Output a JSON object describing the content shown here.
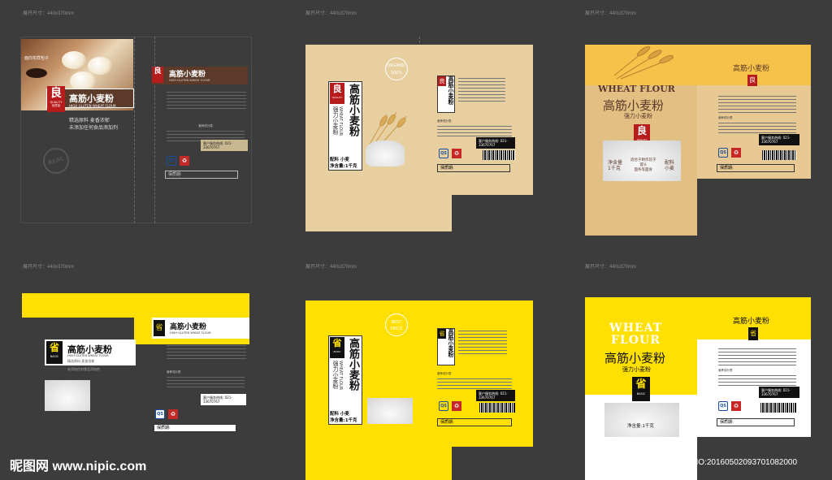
{
  "dim_label": "展开尺寸：440x370mm",
  "brand_liang": "良",
  "brand_quality": "QUALITY",
  "brand_quality_cn": "优质品",
  "brand_sheng": "省",
  "brand_basic": "BASIC",
  "brand_basic_cn": "划算价",
  "product_cn": "高筋小麦粉",
  "product_en": "HIGH GLUTEN WHEAT FLOUR",
  "wheat_flour": "WHEAT FLOUR",
  "wheat_flour_l1": "WHEAT",
  "wheat_flour_l2": "FLOUR",
  "strong_flour": "强力小麦粉",
  "ingredients": "配料 小麦",
  "ingredients_v": "配料\n小麦",
  "net_content": "净含量:1千克",
  "net_content_short": "净含量\n1千克",
  "tagline1": "精选原料 麦香浓郁",
  "tagline2": "未添加任何食品添加剂",
  "usage": "适合于制作饺子\n馒头\n面条等面食",
  "badge_circle1": "ORGANIC\n100%",
  "badge_circle2": "BEST\nPRICE",
  "badge_real": "REAL",
  "bun_label": "面向花样包子",
  "shelf_life": "保质期:",
  "hotline": "客户服务热线:\n021-33670767",
  "table_title": "营养成分表",
  "table_hd": "项目  每100克  NRV%",
  "watermark_left": "昵图网 www.nipic.com",
  "watermark_right": "ID:21631034 NO:20160502093701082000",
  "colors": {
    "kraft": "#e8cfa0",
    "kraft_dark": "#d9b77c",
    "yellow": "#ffe000",
    "brown": "#5b3a2a",
    "red": "#b71c1c",
    "dark": "#3c3c3c"
  }
}
